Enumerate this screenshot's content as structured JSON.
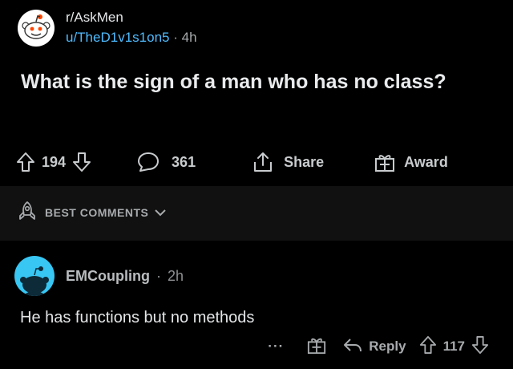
{
  "post": {
    "subreddit": "r/AskMen",
    "username": "u/TheD1v1s1on5",
    "separator": "·",
    "age": "4h",
    "title": "What is the sign of a man who has no class?",
    "score": "194",
    "comments_count": "361",
    "share_label": "Share",
    "award_label": "Award"
  },
  "sort": {
    "label": "BEST COMMENTS"
  },
  "comment": {
    "username": "EMCoupling",
    "separator": "·",
    "age": "2h",
    "body": "He has functions but no methods",
    "more_label": "···",
    "reply_label": "Reply",
    "score": "117"
  },
  "colors": {
    "background": "#000000",
    "username_link": "#4fbcff",
    "comment_avatar": "#38c6f3",
    "sort_band": "#111111"
  },
  "icons": [
    "snoo-avatar-icon",
    "upvote-icon",
    "downvote-icon",
    "comment-icon",
    "share-icon",
    "award-icon",
    "rocket-icon",
    "chevron-down-icon",
    "snoo-head-icon",
    "reply-icon"
  ]
}
